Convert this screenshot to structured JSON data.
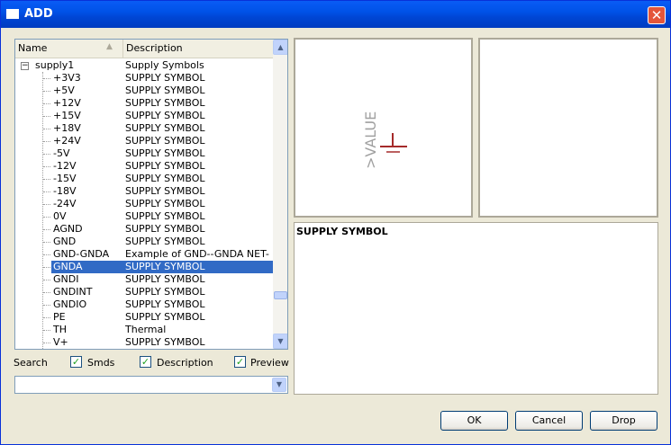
{
  "window": {
    "title": "ADD",
    "close_glyph": "✕"
  },
  "list": {
    "columns": {
      "name": "Name",
      "description": "Description"
    },
    "root": {
      "name": "supply1",
      "description": "Supply Symbols",
      "expander": "−"
    },
    "items": [
      {
        "name": "+3V3",
        "description": "SUPPLY SYMBOL"
      },
      {
        "name": "+5V",
        "description": "SUPPLY SYMBOL"
      },
      {
        "name": "+12V",
        "description": "SUPPLY SYMBOL"
      },
      {
        "name": "+15V",
        "description": "SUPPLY SYMBOL"
      },
      {
        "name": "+18V",
        "description": "SUPPLY SYMBOL"
      },
      {
        "name": "+24V",
        "description": "SUPPLY SYMBOL"
      },
      {
        "name": "-5V",
        "description": "SUPPLY SYMBOL"
      },
      {
        "name": "-12V",
        "description": "SUPPLY SYMBOL"
      },
      {
        "name": "-15V",
        "description": "SUPPLY SYMBOL"
      },
      {
        "name": "-18V",
        "description": "SUPPLY SYMBOL"
      },
      {
        "name": "-24V",
        "description": "SUPPLY SYMBOL"
      },
      {
        "name": "0V",
        "description": "SUPPLY SYMBOL"
      },
      {
        "name": "AGND",
        "description": "SUPPLY SYMBOL"
      },
      {
        "name": "GND",
        "description": "SUPPLY SYMBOL"
      },
      {
        "name": "GND-GNDA",
        "description": "Example of GND--GNDA NET-C..."
      },
      {
        "name": "GNDA",
        "description": "SUPPLY SYMBOL",
        "selected": true
      },
      {
        "name": "GNDI",
        "description": "SUPPLY SYMBOL"
      },
      {
        "name": "GNDINT",
        "description": "SUPPLY SYMBOL"
      },
      {
        "name": "GNDIO",
        "description": "SUPPLY SYMBOL"
      },
      {
        "name": "PE",
        "description": "SUPPLY SYMBOL"
      },
      {
        "name": "TH",
        "description": "Thermal"
      },
      {
        "name": "V+",
        "description": "SUPPLY SYMBOL"
      }
    ]
  },
  "search": {
    "label": "Search",
    "smds": {
      "label": "Smds",
      "checked": true
    },
    "description": {
      "label": "Description",
      "checked": true
    },
    "preview": {
      "label": "Preview",
      "checked": true
    },
    "value": ""
  },
  "preview": {
    "value_label": ">VALUE",
    "symbol_color": "#a52a2a",
    "label_color": "#a0a0a0"
  },
  "description_text": "SUPPLY SYMBOL",
  "buttons": {
    "ok": "OK",
    "cancel": "Cancel",
    "drop": "Drop"
  },
  "glyphs": {
    "check": "✓",
    "arrow_up": "▲",
    "arrow_down": "▼"
  },
  "colors": {
    "selection": "#316ac5",
    "title_bar": "#0052e7"
  }
}
